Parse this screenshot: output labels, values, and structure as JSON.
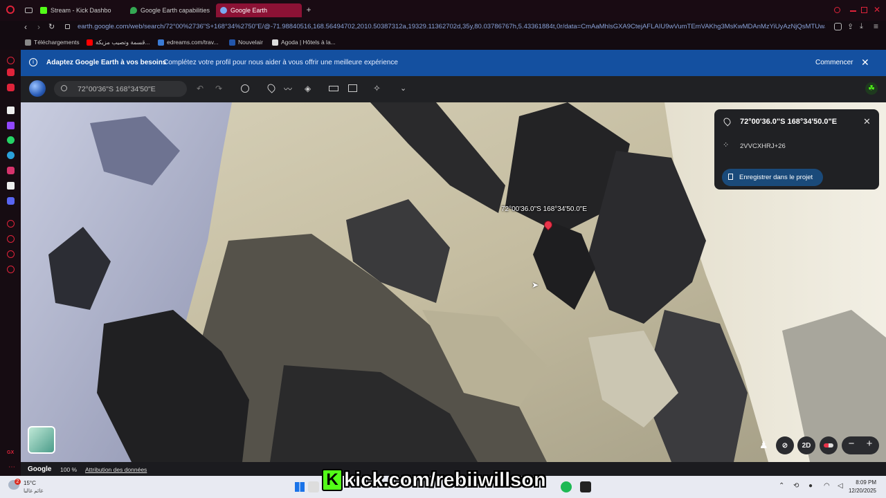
{
  "browser": {
    "tabs": [
      {
        "label": "Stream - Kick Dashbo",
        "color": "#53fc18",
        "active": false
      },
      {
        "label": "Google Earth capabilities",
        "color": "#34a853",
        "active": false
      },
      {
        "label": "Google Earth",
        "color": "#4285f4",
        "active": true
      }
    ],
    "new_tab_label": "+",
    "url": "earth.google.com/web/search/72°00%2736\"S+168°34%2750\"E/@-71.98840516,168.56494702,2010.50387312a,19329.11362702d,35y,80.03786767h,5.43361884t,0r/data=CmAaMhlsGXA9CtejAFLAIU9wVumTEmVAKhg3MsKwMDAnMzYiUyAzNjQsMTUwJzUwIkU",
    "bookmarks": [
      {
        "label": "Téléchargements",
        "color": "#888888"
      },
      {
        "label": "قسمة وتصيب مزيكة...",
        "color": "#ff0000"
      },
      {
        "label": "edreams.com/trav...",
        "color": "#3a7bd5"
      },
      {
        "label": "Nouvelair",
        "color": "#2255aa"
      },
      {
        "label": "Agoda | Hôtels à la...",
        "color": "#dddddd"
      }
    ]
  },
  "banner": {
    "title": "Adaptez Google Earth à vos besoins",
    "text": "Complétez votre profil pour nous aider à vous offrir une meilleure expérience",
    "action": "Commencer",
    "close_icon": "close-icon"
  },
  "earth": {
    "search_value": "72°00'36\"S 168°34'50\"E",
    "marker_label": "72°00'36.0\"S 168°34'50.0\"E",
    "card": {
      "coords": "72°00'36.0\"S 168°34'50.0\"E",
      "plus_code": "2VVCXHRJ+26",
      "save_label": "Enregistrer dans le projet"
    },
    "view_mode": "2D",
    "zoom_out": "−",
    "zoom_in": "+"
  },
  "statusbar": {
    "brand": "Google",
    "zoom": "100 %",
    "attribution": "Attribution des données"
  },
  "overlay": {
    "kick_logo": "K",
    "kick_text": "kick.com/rebiiwillson"
  },
  "taskbar": {
    "weather_temp": "15°C",
    "weather_desc": "غائم غالبا",
    "weather_badge": "2",
    "time": "8:09 PM",
    "date": "12/20/2025"
  },
  "colors": {
    "accent": "#1a73e8",
    "marker": "#e8344a",
    "kick_green": "#53fc18",
    "banner": "#1450a0"
  }
}
